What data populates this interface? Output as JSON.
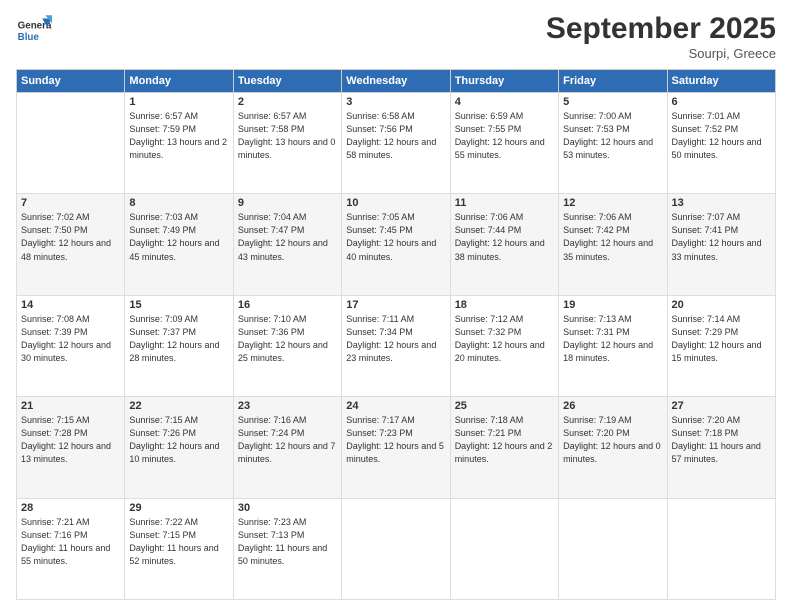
{
  "logo": {
    "line1": "General",
    "line2": "Blue"
  },
  "header": {
    "month": "September 2025",
    "location": "Sourpi, Greece"
  },
  "weekdays": [
    "Sunday",
    "Monday",
    "Tuesday",
    "Wednesday",
    "Thursday",
    "Friday",
    "Saturday"
  ],
  "weeks": [
    [
      {
        "day": "",
        "sunrise": "",
        "sunset": "",
        "daylight": ""
      },
      {
        "day": "1",
        "sunrise": "Sunrise: 6:57 AM",
        "sunset": "Sunset: 7:59 PM",
        "daylight": "Daylight: 13 hours and 2 minutes."
      },
      {
        "day": "2",
        "sunrise": "Sunrise: 6:57 AM",
        "sunset": "Sunset: 7:58 PM",
        "daylight": "Daylight: 13 hours and 0 minutes."
      },
      {
        "day": "3",
        "sunrise": "Sunrise: 6:58 AM",
        "sunset": "Sunset: 7:56 PM",
        "daylight": "Daylight: 12 hours and 58 minutes."
      },
      {
        "day": "4",
        "sunrise": "Sunrise: 6:59 AM",
        "sunset": "Sunset: 7:55 PM",
        "daylight": "Daylight: 12 hours and 55 minutes."
      },
      {
        "day": "5",
        "sunrise": "Sunrise: 7:00 AM",
        "sunset": "Sunset: 7:53 PM",
        "daylight": "Daylight: 12 hours and 53 minutes."
      },
      {
        "day": "6",
        "sunrise": "Sunrise: 7:01 AM",
        "sunset": "Sunset: 7:52 PM",
        "daylight": "Daylight: 12 hours and 50 minutes."
      }
    ],
    [
      {
        "day": "7",
        "sunrise": "Sunrise: 7:02 AM",
        "sunset": "Sunset: 7:50 PM",
        "daylight": "Daylight: 12 hours and 48 minutes."
      },
      {
        "day": "8",
        "sunrise": "Sunrise: 7:03 AM",
        "sunset": "Sunset: 7:49 PM",
        "daylight": "Daylight: 12 hours and 45 minutes."
      },
      {
        "day": "9",
        "sunrise": "Sunrise: 7:04 AM",
        "sunset": "Sunset: 7:47 PM",
        "daylight": "Daylight: 12 hours and 43 minutes."
      },
      {
        "day": "10",
        "sunrise": "Sunrise: 7:05 AM",
        "sunset": "Sunset: 7:45 PM",
        "daylight": "Daylight: 12 hours and 40 minutes."
      },
      {
        "day": "11",
        "sunrise": "Sunrise: 7:06 AM",
        "sunset": "Sunset: 7:44 PM",
        "daylight": "Daylight: 12 hours and 38 minutes."
      },
      {
        "day": "12",
        "sunrise": "Sunrise: 7:06 AM",
        "sunset": "Sunset: 7:42 PM",
        "daylight": "Daylight: 12 hours and 35 minutes."
      },
      {
        "day": "13",
        "sunrise": "Sunrise: 7:07 AM",
        "sunset": "Sunset: 7:41 PM",
        "daylight": "Daylight: 12 hours and 33 minutes."
      }
    ],
    [
      {
        "day": "14",
        "sunrise": "Sunrise: 7:08 AM",
        "sunset": "Sunset: 7:39 PM",
        "daylight": "Daylight: 12 hours and 30 minutes."
      },
      {
        "day": "15",
        "sunrise": "Sunrise: 7:09 AM",
        "sunset": "Sunset: 7:37 PM",
        "daylight": "Daylight: 12 hours and 28 minutes."
      },
      {
        "day": "16",
        "sunrise": "Sunrise: 7:10 AM",
        "sunset": "Sunset: 7:36 PM",
        "daylight": "Daylight: 12 hours and 25 minutes."
      },
      {
        "day": "17",
        "sunrise": "Sunrise: 7:11 AM",
        "sunset": "Sunset: 7:34 PM",
        "daylight": "Daylight: 12 hours and 23 minutes."
      },
      {
        "day": "18",
        "sunrise": "Sunrise: 7:12 AM",
        "sunset": "Sunset: 7:32 PM",
        "daylight": "Daylight: 12 hours and 20 minutes."
      },
      {
        "day": "19",
        "sunrise": "Sunrise: 7:13 AM",
        "sunset": "Sunset: 7:31 PM",
        "daylight": "Daylight: 12 hours and 18 minutes."
      },
      {
        "day": "20",
        "sunrise": "Sunrise: 7:14 AM",
        "sunset": "Sunset: 7:29 PM",
        "daylight": "Daylight: 12 hours and 15 minutes."
      }
    ],
    [
      {
        "day": "21",
        "sunrise": "Sunrise: 7:15 AM",
        "sunset": "Sunset: 7:28 PM",
        "daylight": "Daylight: 12 hours and 13 minutes."
      },
      {
        "day": "22",
        "sunrise": "Sunrise: 7:15 AM",
        "sunset": "Sunset: 7:26 PM",
        "daylight": "Daylight: 12 hours and 10 minutes."
      },
      {
        "day": "23",
        "sunrise": "Sunrise: 7:16 AM",
        "sunset": "Sunset: 7:24 PM",
        "daylight": "Daylight: 12 hours and 7 minutes."
      },
      {
        "day": "24",
        "sunrise": "Sunrise: 7:17 AM",
        "sunset": "Sunset: 7:23 PM",
        "daylight": "Daylight: 12 hours and 5 minutes."
      },
      {
        "day": "25",
        "sunrise": "Sunrise: 7:18 AM",
        "sunset": "Sunset: 7:21 PM",
        "daylight": "Daylight: 12 hours and 2 minutes."
      },
      {
        "day": "26",
        "sunrise": "Sunrise: 7:19 AM",
        "sunset": "Sunset: 7:20 PM",
        "daylight": "Daylight: 12 hours and 0 minutes."
      },
      {
        "day": "27",
        "sunrise": "Sunrise: 7:20 AM",
        "sunset": "Sunset: 7:18 PM",
        "daylight": "Daylight: 11 hours and 57 minutes."
      }
    ],
    [
      {
        "day": "28",
        "sunrise": "Sunrise: 7:21 AM",
        "sunset": "Sunset: 7:16 PM",
        "daylight": "Daylight: 11 hours and 55 minutes."
      },
      {
        "day": "29",
        "sunrise": "Sunrise: 7:22 AM",
        "sunset": "Sunset: 7:15 PM",
        "daylight": "Daylight: 11 hours and 52 minutes."
      },
      {
        "day": "30",
        "sunrise": "Sunrise: 7:23 AM",
        "sunset": "Sunset: 7:13 PM",
        "daylight": "Daylight: 11 hours and 50 minutes."
      },
      {
        "day": "",
        "sunrise": "",
        "sunset": "",
        "daylight": ""
      },
      {
        "day": "",
        "sunrise": "",
        "sunset": "",
        "daylight": ""
      },
      {
        "day": "",
        "sunrise": "",
        "sunset": "",
        "daylight": ""
      },
      {
        "day": "",
        "sunrise": "",
        "sunset": "",
        "daylight": ""
      }
    ]
  ]
}
